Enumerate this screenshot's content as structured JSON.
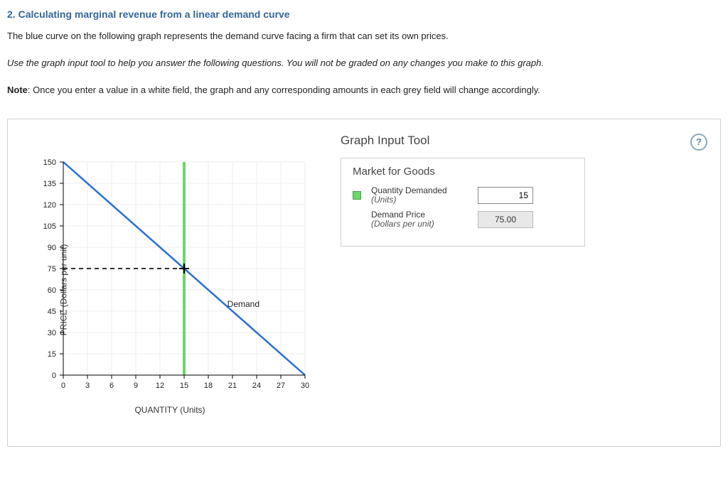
{
  "question": {
    "number": "2.",
    "title": "Calculating marginal revenue from a linear demand curve"
  },
  "paragraphs": {
    "p1": "The blue curve on the following graph represents the demand curve facing a firm that can set its own prices.",
    "p2": "Use the graph input tool to help you answer the following questions. You will not be graded on any changes you make to this graph.",
    "p3_before": "Note",
    "p3_after": ": Once you enter a value in a white field, the graph and any corresponding amounts in each grey field will change accordingly."
  },
  "tool": {
    "title": "Graph Input Tool",
    "market_title": "Market for Goods",
    "help_glyph": "?",
    "fields": {
      "qty_label": "Quantity Demanded",
      "qty_sub": "(Units)",
      "qty_value": "15",
      "price_label": "Demand Price",
      "price_sub": "(Dollars per unit)",
      "price_value": "75.00"
    }
  },
  "chart_data": {
    "type": "line",
    "title": "",
    "xlabel": "QUANTITY (Units)",
    "ylabel": "PRICE (Dollars per unit)",
    "xlim": [
      0,
      30
    ],
    "ylim": [
      0,
      150
    ],
    "x_ticks": [
      0,
      3,
      6,
      9,
      12,
      15,
      18,
      21,
      24,
      27,
      30
    ],
    "y_ticks": [
      0,
      15,
      30,
      45,
      60,
      75,
      90,
      105,
      120,
      135,
      150
    ],
    "series": [
      {
        "name": "Demand",
        "x": [
          0,
          30
        ],
        "y": [
          150,
          0
        ],
        "color": "#2a6fd6"
      }
    ],
    "marker": {
      "x": 15,
      "y": 75,
      "vline_color": "#5fcf5f",
      "hline_dashed": true
    }
  }
}
